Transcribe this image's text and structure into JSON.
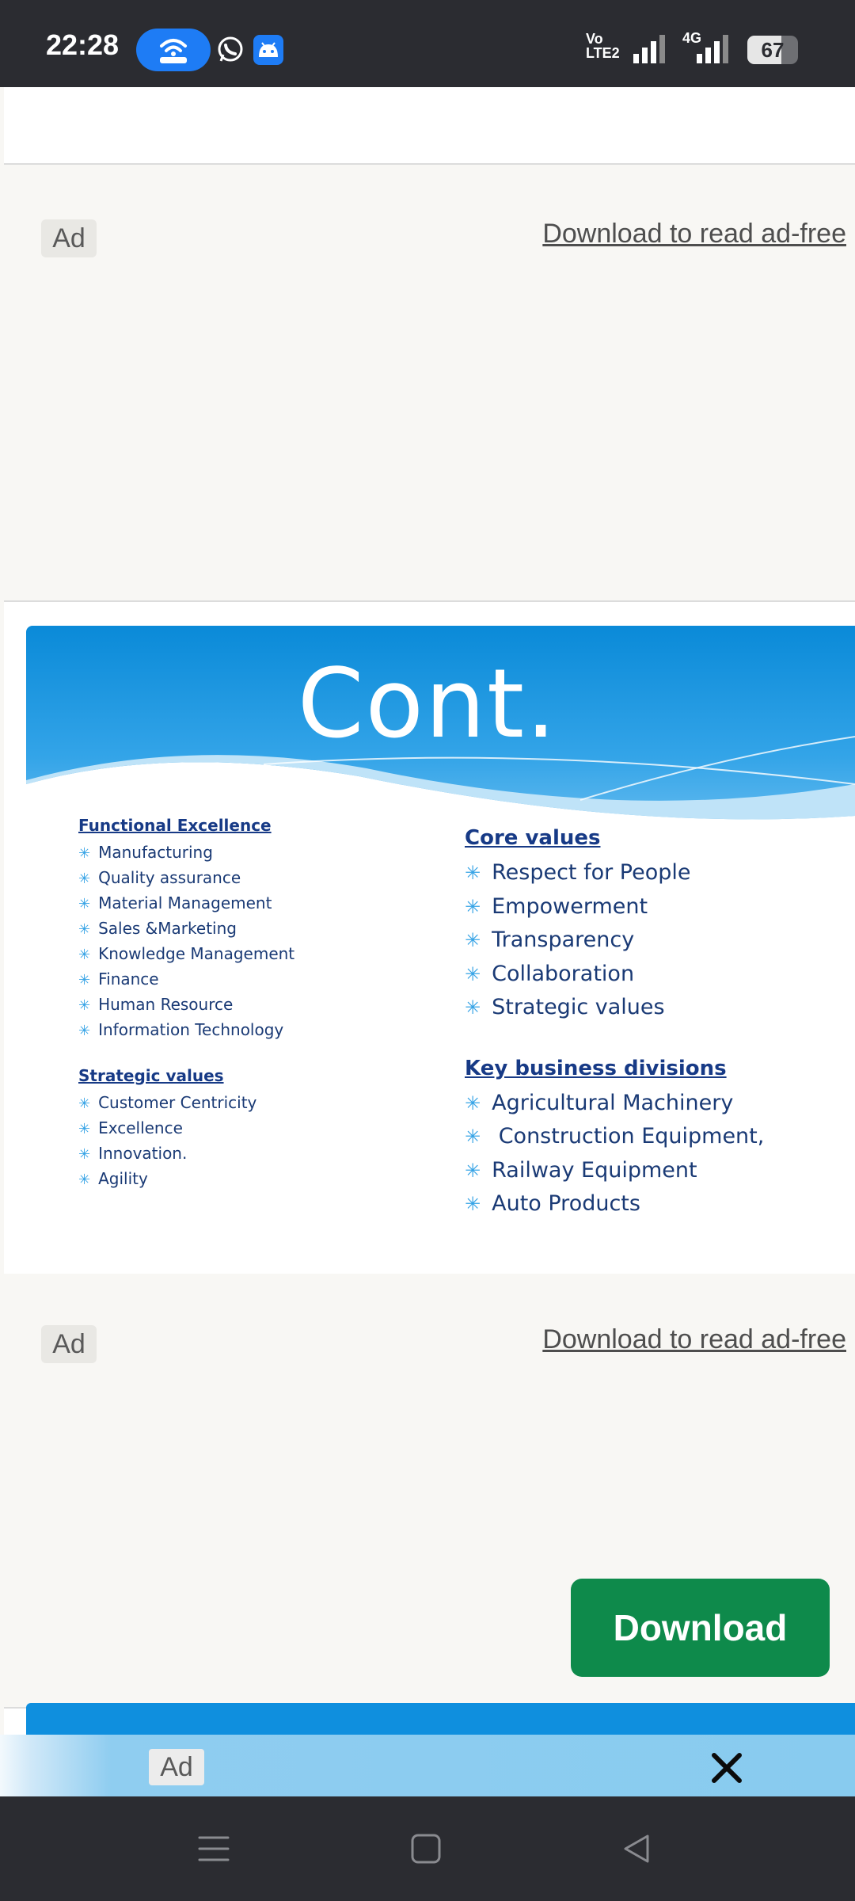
{
  "status_bar": {
    "time": "22:28",
    "network_label": "Vo LTE2",
    "network_type": "4G",
    "battery_level": "67",
    "icons": [
      "hotspot-icon",
      "whatsapp-icon",
      "android-icon",
      "signal-icon",
      "battery-icon"
    ]
  },
  "ads": {
    "badge_label": "Ad",
    "ad_free_link": "Download to read ad-free"
  },
  "slide": {
    "title": "Cont.",
    "left_column": {
      "functional_heading": "Functional Excellence",
      "functional_items": [
        "Manufacturing",
        "Quality assurance",
        "Material Management",
        "Sales &Marketing",
        "Knowledge Management",
        "Finance",
        "Human Resource",
        "Information Technology"
      ],
      "strategic_heading": "Strategic values",
      "strategic_items": [
        "Customer Centricity",
        "Excellence",
        "Innovation.",
        "Agility"
      ]
    },
    "right_column": {
      "core_heading": "Core values",
      "core_items": [
        "Respect for People",
        "Empowerment",
        "Transparency",
        "Collaboration",
        "Strategic values"
      ],
      "divisions_heading": "Key business divisions",
      "divisions_items": [
        "Agricultural Machinery",
        " Construction Equipment,",
        "Railway Equipment",
        "Auto Products"
      ]
    },
    "bullet_glyph": "✳",
    "accent_color": "#36a3e6",
    "text_color": "#1a3a75"
  },
  "download_button": {
    "label": "Download",
    "color": "#0e8a4b"
  },
  "bottom_banner": {
    "badge_label": "Ad",
    "close_symbol": "✕"
  },
  "nav_bar": {
    "icons": [
      "menu-icon",
      "home-icon",
      "back-icon"
    ]
  }
}
